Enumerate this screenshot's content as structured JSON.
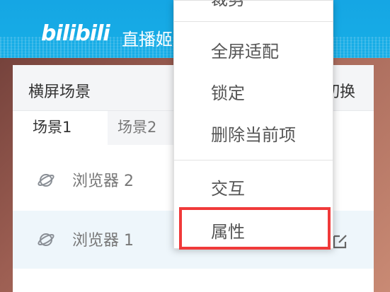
{
  "header": {
    "logo_text": "bilibili",
    "title": "直播姬"
  },
  "panel": {
    "title": "横屏场景",
    "switch_label": "切换",
    "tabs": [
      {
        "label": "场景1",
        "active": true
      },
      {
        "label": "场景2",
        "active": false
      }
    ],
    "rows": [
      {
        "label": "浏览器 2",
        "icon": "planet-icon"
      },
      {
        "label": "浏览器 1",
        "icon": "planet-icon",
        "has_edit": true
      }
    ]
  },
  "context_menu": {
    "items": [
      {
        "label": "裁剪"
      },
      {
        "label": "全屏适配"
      },
      {
        "label": "锁定"
      },
      {
        "label": "删除当前项"
      },
      {
        "label": "交互"
      },
      {
        "label": "属性",
        "highlighted": true
      }
    ]
  },
  "colors": {
    "header_blue": "#16a9e5",
    "highlight_red": "#f03a3a",
    "selected_row": "#eef6fb"
  }
}
